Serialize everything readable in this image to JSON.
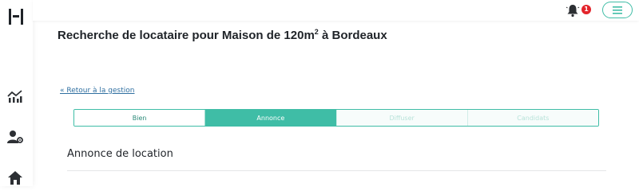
{
  "header": {
    "notification_count": "1"
  },
  "page": {
    "title_main": "Recherche de locataire pour Maison de 120m",
    "title_sup": "2",
    "title_tail": " à Bordeaux",
    "back_link": "« Retour à la gestion",
    "section_title": "Annonce de location"
  },
  "stepper": {
    "steps": [
      {
        "label": "Bien",
        "state": "done"
      },
      {
        "label": "Annonce",
        "state": "active"
      },
      {
        "label": "Diffuser",
        "state": "todo"
      },
      {
        "label": "Candidats",
        "state": "todo"
      }
    ]
  },
  "sidebar": {
    "icons": [
      "analytics-icon",
      "user-settings-icon",
      "home-icon"
    ]
  },
  "colors": {
    "accent": "#3fbda6",
    "badge": "#e3242b",
    "link": "#2f6fa0"
  }
}
